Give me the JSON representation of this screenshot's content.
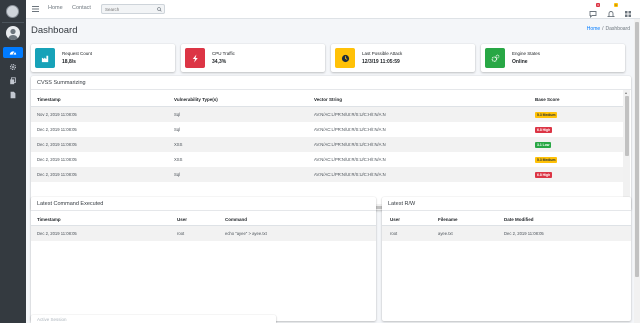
{
  "topbar": {
    "nav_links": [
      "Home",
      "Contact"
    ],
    "search_placeholder": "Search",
    "notifications_count": "3",
    "messages_count": "1"
  },
  "page": {
    "title": "Dashboard",
    "breadcrumb": [
      "Home",
      "Dashboard"
    ]
  },
  "info_boxes": [
    {
      "label": "Request Count",
      "value": "18,8/s",
      "icon": "factory-icon",
      "color": "#17a2b8"
    },
    {
      "label": "CPU Traffic",
      "value": "34,3%",
      "icon": "bolt-icon",
      "color": "#dc3545"
    },
    {
      "label": "Last Possible Attack",
      "value": "12/3/19 11:05:59",
      "icon": "clock-icon",
      "color": "#ffc107"
    },
    {
      "label": "Engine States",
      "value": "Online",
      "icon": "gears-icon",
      "color": "#28a745"
    }
  ],
  "cvss": {
    "title": "CVSS Summarizing",
    "columns": [
      "Timestamp",
      "Vulnerability Type(s)",
      "Vector String",
      "Base Score"
    ],
    "rows": [
      {
        "timestamp": "Nov 2, 2019 11:08:05",
        "type": "Sql",
        "vector": "AV:N/AC:L/PR:N/UI:R/S:U/C:H/I:N/A:N",
        "score": "5.3 Medium",
        "level": "medium"
      },
      {
        "timestamp": "Dec 2, 2019 11:08:05",
        "type": "Sql",
        "vector": "AV:N/AC:L/PR:N/UI:R/S:U/C:H/I:N/A:N",
        "score": "6.8 High",
        "level": "high"
      },
      {
        "timestamp": "Dec 2, 2019 11:08:05",
        "type": "XSS",
        "vector": "AV:N/AC:L/PR:N/UI:R/S:U/C:H/I:N/A:N",
        "score": "3.1 Low",
        "level": "low"
      },
      {
        "timestamp": "Dec 2, 2019 11:08:05",
        "type": "XSS",
        "vector": "AV:N/AC:L/PR:N/UI:R/S:U/C:H/I:N/A:N",
        "score": "5.3 Medium",
        "level": "medium"
      },
      {
        "timestamp": "Dec 2, 2019 11:08:05",
        "type": "Sql",
        "vector": "AV:N/AC:L/PR:N/UI:R/S:U/C:H/I:N/A:N",
        "score": "6.8 High",
        "level": "high"
      }
    ]
  },
  "commands": {
    "title": "Latest Command Executed",
    "columns": [
      "Timestamp",
      "User",
      "Command"
    ],
    "rows": [
      {
        "timestamp": "Dec 2, 2019 11:08:05",
        "user": "root",
        "command": "echo \"ayee\" > ayee.txt"
      }
    ]
  },
  "rw": {
    "title": "Latest R/W",
    "columns": [
      "User",
      "Filename",
      "Date Modified"
    ],
    "rows": [
      {
        "user": "root",
        "filename": "ayee.txt",
        "date": "Dec 2, 2019 11:08:05"
      }
    ]
  },
  "partial_card": {
    "title": "Active Session"
  },
  "colors": {
    "primary": "#007bff",
    "sidebar": "#343a40"
  }
}
